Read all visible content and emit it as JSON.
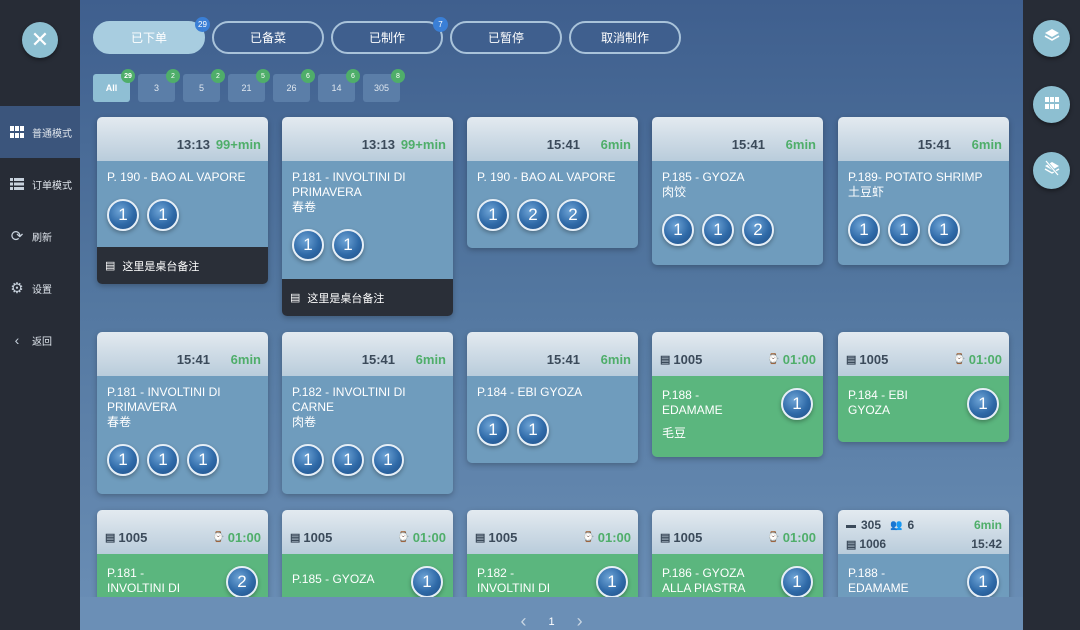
{
  "sidebar": {
    "close_icon": "close-icon",
    "items": [
      {
        "label": "普通模式",
        "icon": "grid-icon",
        "active": true
      },
      {
        "label": "订单模式",
        "icon": "list-icon"
      },
      {
        "label": "刷新",
        "icon": "refresh-icon"
      },
      {
        "label": "设置",
        "icon": "gear-icon"
      },
      {
        "label": "返回",
        "icon": "chevron-left-icon"
      }
    ]
  },
  "tabs": [
    {
      "label": "已下单",
      "badge": "29",
      "active": true
    },
    {
      "label": "已备菜",
      "badge": ""
    },
    {
      "label": "已制作",
      "badge": "7"
    },
    {
      "label": "已暂停",
      "badge": ""
    },
    {
      "label": "取消制作",
      "badge": ""
    }
  ],
  "filters": [
    {
      "label": "All",
      "count": "29",
      "active": true
    },
    {
      "label": "3",
      "count": "2"
    },
    {
      "label": "5",
      "count": "2"
    },
    {
      "label": "21",
      "count": "5"
    },
    {
      "label": "26",
      "count": "6"
    },
    {
      "label": "14",
      "count": "6"
    },
    {
      "label": "305",
      "count": "8"
    }
  ],
  "cards": [
    {
      "time": "13:13",
      "elapsed": "99+min",
      "name": "P. 190 - BAO AL VAPORE",
      "sub": "",
      "qtys": [
        "1",
        "1"
      ],
      "note": "这里是桌台备注"
    },
    {
      "time": "13:13",
      "elapsed": "99+min",
      "name": "P.181 - INVOLTINI DI PRIMAVERA",
      "sub": "春卷",
      "qtys": [
        "1",
        "1"
      ],
      "note": "这里是桌台备注"
    },
    {
      "time": "15:41",
      "elapsed": "6min",
      "name": "P. 190 - BAO AL VAPORE",
      "sub": "",
      "qtys": [
        "1",
        "2",
        "2"
      ],
      "note": ""
    },
    {
      "time": "15:41",
      "elapsed": "6min",
      "name": "P.185 - GYOZA",
      "sub": "肉饺",
      "qtys": [
        "1",
        "1",
        "2"
      ],
      "note": ""
    },
    {
      "time": "15:41",
      "elapsed": "6min",
      "name": "P.189- POTATO SHRIMP",
      "sub": "土豆虾",
      "qtys": [
        "1",
        "1",
        "1"
      ],
      "note": ""
    },
    {
      "time": "15:41",
      "elapsed": "6min",
      "name": "P.181 - INVOLTINI DI PRIMAVERA",
      "sub": "春卷",
      "qtys": [
        "1",
        "1",
        "1"
      ],
      "note": ""
    },
    {
      "time": "15:41",
      "elapsed": "6min",
      "name": "P.182 - INVOLTINI DI CARNE",
      "sub": "肉卷",
      "qtys": [
        "1",
        "1",
        "1"
      ],
      "note": ""
    },
    {
      "time": "15:41",
      "elapsed": "6min",
      "name": "P.184 - EBI GYOZA",
      "sub": "",
      "qtys": [
        "1",
        "1"
      ],
      "note": ""
    },
    {
      "table": "1005",
      "timer": "01:00",
      "name": "P.188 - EDAMAME",
      "sub": "毛豆",
      "qty": "1"
    },
    {
      "table": "1005",
      "timer": "01:00",
      "name": "P.184 - EBI GYOZA",
      "sub": "",
      "qty": "1"
    },
    {
      "table": "1005",
      "timer": "01:00",
      "name": "P.181 - INVOLTINI DI",
      "sub": "",
      "qty": "2"
    },
    {
      "table": "1005",
      "timer": "01:00",
      "name": "P.185 - GYOZA",
      "sub": "",
      "qty": "1"
    },
    {
      "table": "1005",
      "timer": "01:00",
      "name": "P.182 - INVOLTINI DI",
      "sub": "",
      "qty": "1"
    },
    {
      "table": "1005",
      "timer": "01:00",
      "name": "P.186 - GYOZA ALLA PIASTRA",
      "sub": "",
      "qty": "1"
    },
    {
      "seat": "305",
      "guests": "6",
      "elapsed": "6min",
      "table": "1006",
      "time": "15:42",
      "name": "P.188 - EDAMAME",
      "qty": "1"
    }
  ],
  "pager": {
    "prev": "‹",
    "page": "1",
    "next": "›"
  }
}
